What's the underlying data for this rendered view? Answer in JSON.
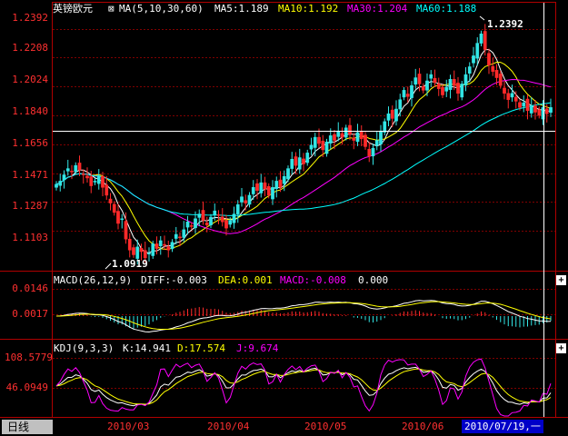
{
  "colors": {
    "up": "#32e6e6",
    "down": "#ff2a2a",
    "ma5": "#ffffff",
    "ma10": "#ffff00",
    "ma30": "#ff00ff",
    "ma60": "#00ffff",
    "axis": "#ff3030",
    "grid": "#800000"
  },
  "price_panel": {
    "name": "英镑欧元",
    "indicator": "MA(5,10,30,60)",
    "ma5_label": "MA5:1.189",
    "ma10_label": "MA10:1.192",
    "ma30_label": "MA30:1.204",
    "ma60_label": "MA60:1.188",
    "yticks": [
      "1.2392",
      "1.2208",
      "1.2024",
      "1.1840",
      "1.1656",
      "1.1471",
      "1.1287",
      "1.1103"
    ],
    "high_mark": "1.2392",
    "low_mark": "1.0919",
    "crosshair_price": 1.174
  },
  "macd_panel": {
    "title": "MACD(26,12,9)",
    "diff": "DIFF:-0.003",
    "dea": "DEA:0.001",
    "macd": "MACD:-0.008",
    "extra": "0.000",
    "yticks": [
      "0.0146",
      "0.0017"
    ]
  },
  "kdj_panel": {
    "title": "KDJ(9,3,3)",
    "k": "K:14.941",
    "d": "D:17.574",
    "j": "J:9.674",
    "yticks": [
      "108.5779",
      "46.0949"
    ]
  },
  "bottom": {
    "period_tab": "日线",
    "dates": [
      "2010/03",
      "2010/04",
      "2010/05",
      "2010/06"
    ],
    "cursor_date": "2010/07/19,一"
  },
  "chart_data": {
    "type": "candlestick",
    "ylim": [
      1.086,
      1.246
    ],
    "dates": [
      "2010/03",
      "2010/04",
      "2010/05",
      "2010/06"
    ],
    "closes": [
      1.14,
      1.142,
      1.146,
      1.15,
      1.148,
      1.152,
      1.149,
      1.146,
      1.144,
      1.139,
      1.142,
      1.145,
      1.138,
      1.133,
      1.128,
      1.122,
      1.115,
      1.118,
      1.105,
      1.098,
      1.095,
      1.1,
      1.097,
      1.093,
      1.096,
      1.102,
      1.099,
      1.104,
      1.101,
      1.098,
      1.103,
      1.108,
      1.106,
      1.111,
      1.116,
      1.113,
      1.118,
      1.121,
      1.117,
      1.114,
      1.119,
      1.123,
      1.12,
      1.116,
      1.112,
      1.117,
      1.121,
      1.127,
      1.132,
      1.128,
      1.133,
      1.138,
      1.136,
      1.141,
      1.137,
      1.133,
      1.138,
      1.142,
      1.138,
      1.145,
      1.15,
      1.156,
      1.152,
      1.157,
      1.153,
      1.16,
      1.165,
      1.17,
      1.166,
      1.162,
      1.167,
      1.171,
      1.168,
      1.174,
      1.17,
      1.176,
      1.172,
      1.168,
      1.173,
      1.169,
      1.164,
      1.158,
      1.163,
      1.168,
      1.174,
      1.18,
      1.185,
      1.182,
      1.188,
      1.194,
      1.2,
      1.196,
      1.203,
      1.208,
      1.204,
      1.2,
      1.206,
      1.21,
      1.205,
      1.201,
      1.197,
      1.202,
      1.207,
      1.203,
      1.198,
      1.204,
      1.21,
      1.215,
      1.222,
      1.23,
      1.236,
      1.226,
      1.216,
      1.212,
      1.208,
      1.203,
      1.198,
      1.194,
      1.198,
      1.193,
      1.189,
      1.192,
      1.187,
      1.19,
      1.186,
      1.184,
      1.189,
      1.185,
      1.189
    ]
  }
}
